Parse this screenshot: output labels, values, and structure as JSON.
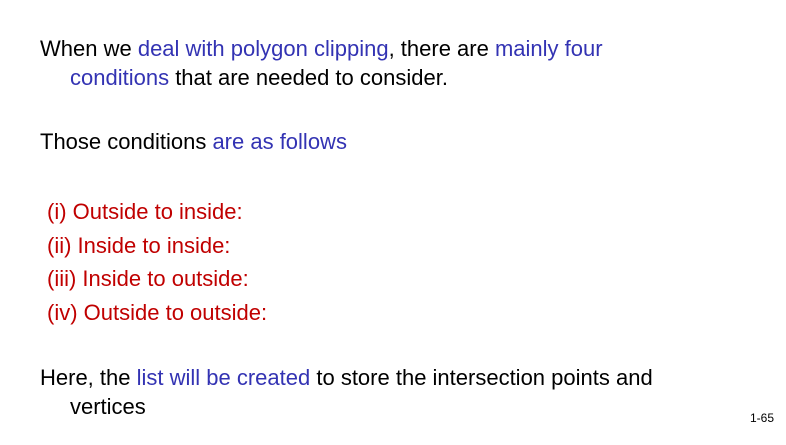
{
  "paragraph1": {
    "t1": "When we ",
    "h1": "deal with polygon clipping",
    "t2": ", there are ",
    "h2": "mainly four",
    "h3": "conditions",
    "t3": " that are needed to consider."
  },
  "paragraph2": {
    "t1": "Those conditions ",
    "h1": "are as follows"
  },
  "conditions": [
    "(i) Outside to inside:",
    "(ii) Inside to inside:",
    "(iii) Inside to outside:",
    "(iv) Outside to outside:"
  ],
  "paragraph3": {
    "t1": "Here, the ",
    "h1": "list will be created",
    "t2": " to store the intersection points and",
    "t3": "vertices"
  },
  "slide_number": "1-65",
  "colors": {
    "highlight": "#3333b3",
    "condition": "#c00000",
    "text": "#000000"
  }
}
